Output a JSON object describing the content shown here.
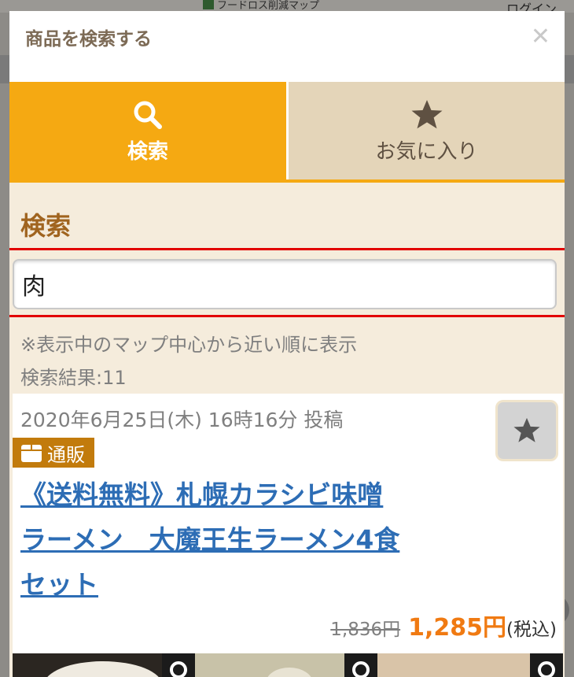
{
  "background": {
    "map_label": "フードロス削減マップ",
    "login": "ログイン"
  },
  "modal": {
    "title": "商品を検索する",
    "close_icon": "close-icon",
    "tabs": [
      {
        "label": "検索",
        "icon": "search-icon",
        "active": true
      },
      {
        "label": "お気に入り",
        "icon": "star-icon",
        "active": false
      }
    ],
    "search": {
      "heading": "検索",
      "query": "肉",
      "note": "※表示中のマップ中心から近い順に表示",
      "result_count": "検索結果:11"
    },
    "results": [
      {
        "posted": "2020年6月25日(木) 16時16分 投稿",
        "badge": "通販",
        "title_lines": [
          "《送料無料》札幌カラシビ味噌",
          "ラーメン　大魔王生ラーメン4食",
          "セット"
        ],
        "price_original": "1,836円",
        "price_sale": "1,285円",
        "price_tax": "(税込)"
      }
    ]
  },
  "colors": {
    "accent": "#f5a912",
    "panel_bg": "#f5ecdc",
    "link": "#2d6db5",
    "sale_price": "#f07a12",
    "badge_bg": "#c27b0c",
    "heading": "#a0641f"
  }
}
